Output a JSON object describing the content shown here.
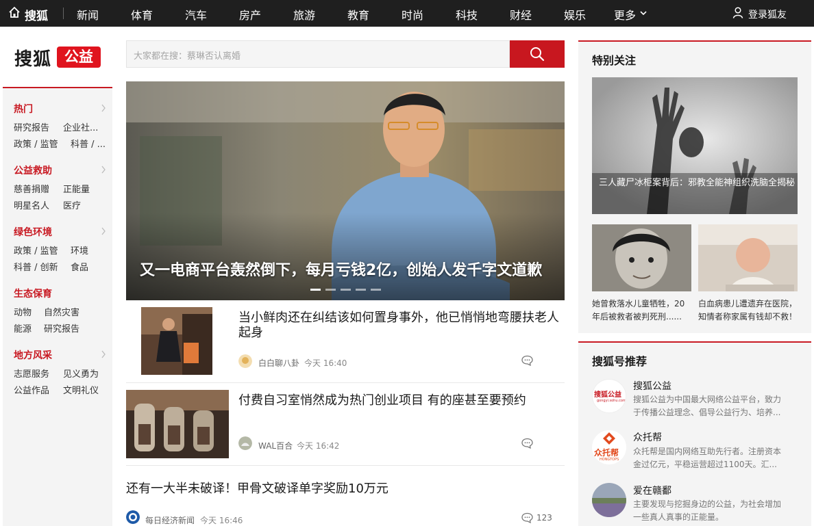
{
  "topnav": {
    "brand": "搜狐",
    "items": [
      "新闻",
      "体育",
      "汽车",
      "房产",
      "旅游",
      "教育",
      "时尚",
      "科技",
      "财经",
      "娱乐",
      "更多"
    ],
    "login": "登录狐友"
  },
  "logo": {
    "text": "搜狐",
    "badge": "公益"
  },
  "sidebar": {
    "categories": [
      {
        "label": "热门",
        "subs": [
          "研究报告",
          "企业社...",
          "政策 / 监管",
          "科普 / ..."
        ]
      },
      {
        "label": "公益救助",
        "subs": [
          "慈善捐赠",
          "正能量",
          "明星名人",
          "医疗"
        ]
      },
      {
        "label": "绿色环境",
        "subs": [
          "政策 / 监管",
          "环境",
          "科普 / 创新",
          "食品"
        ]
      },
      {
        "label": "生态保育",
        "subs": [
          "动物",
          "自然灾害",
          "能源",
          "研究报告"
        ]
      },
      {
        "label": "地方风采",
        "subs": [
          "志愿服务",
          "见义勇为",
          "公益作品",
          "文明礼仪"
        ]
      }
    ]
  },
  "search": {
    "placeholder": "大家都在搜：蔡琳否认离婚"
  },
  "hero": {
    "caption": "又一电商平台轰然倒下，每月亏钱2亿，创始人发千字文道歉",
    "slide_count": 5,
    "active_slide": 1
  },
  "feed": [
    {
      "title": "当小鲜肉还在纠结该如何置身事外，他已悄悄地弯腰扶老人起身",
      "author": "白白聊八卦",
      "time": "今天 16:40",
      "comments": ""
    },
    {
      "title": "付费自习室悄然成为热门创业项目 有的座甚至要预约",
      "author": "WAL百合",
      "time": "今天 16:42",
      "comments": ""
    },
    {
      "title": "还有一大半未破译！甲骨文破译单字奖励10万元",
      "author": "每日经济新闻",
      "time": "今天 16:46",
      "comments": "123"
    }
  ],
  "special": {
    "title": "特别关注",
    "main_caption": "三人藏尸冰柜案背后：邪教全能神组织洗脑全揭秘",
    "left_caption": "她曾救落水儿童牺牲，20年后被救者被判死刑......",
    "right_caption": "白血病患儿遭遗弃在医院，知情者称家属有钱却不救！"
  },
  "recommend": {
    "title": "搜狐号推荐",
    "accounts": [
      {
        "name": "搜狐公益",
        "logo_text": "搜狐公益",
        "logo_sub": "gongyi.sohu.com",
        "desc": "搜狐公益为中国最大网络公益平台，致力于传播公益理念、倡导公益行为、培养..."
      },
      {
        "name": "众托帮",
        "logo_text": "众托帮",
        "logo_sub": "HONGTOPS",
        "desc": "众托帮是国内网络互助先行者。注册资本金过亿元，平稳运营超过1100天。汇..."
      },
      {
        "name": "爱在赣鄱",
        "desc": "主要发现与挖掘身边的公益，为社会增加一些真人真事的正能量。"
      }
    ]
  },
  "colors": {
    "brand_red": "#c81922",
    "nav_bg": "#1f1f1f"
  }
}
